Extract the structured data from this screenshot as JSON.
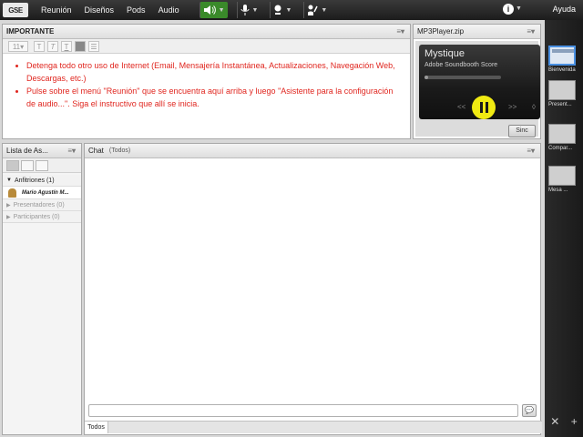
{
  "menu": {
    "logo": "GSE",
    "items": [
      "Reunión",
      "Diseños",
      "Pods",
      "Audio"
    ],
    "help": "Ayuda"
  },
  "notes_pod": {
    "title": "IMPORTANTE",
    "bullets": [
      "Detenga todo otro uso de Internet (Email, Mensajería Instantánea, Actualizaciones, Navegación Web, Descargas, etc.)",
      "Pulse sobre el menú \"Reunión\" que se encuentra aquí arriba y luego \"Asistente para la configuración de audio...\". Siga el instructivo que allí se inicia."
    ]
  },
  "mp3_pod": {
    "title": "MP3Player.zip",
    "track": "Mystique",
    "artist": "Adobe Soundbooth Score",
    "progress": 0.05,
    "prev": "<<",
    "next": ">>",
    "sync_label": "Sinc"
  },
  "attendees_pod": {
    "title": "Lista de As...",
    "groups": [
      {
        "label": "Anfitriones (1)",
        "expanded": true
      },
      {
        "label": "Presentadores (0)",
        "expanded": false
      },
      {
        "label": "Participantes (0)",
        "expanded": false
      }
    ],
    "hosts": [
      "Mario Agustín M..."
    ]
  },
  "chat_pod": {
    "title": "Chat",
    "subtitle": "(Todos)",
    "tab": "Todos"
  },
  "layouts": [
    {
      "label": "Bienvenida",
      "selected": true
    },
    {
      "label": "Present...",
      "selected": false
    },
    {
      "label": "Compar...",
      "selected": false
    },
    {
      "label": "Mesa ...",
      "selected": false
    }
  ],
  "colors": {
    "notes_text": "#e0261f",
    "mic_active": "#3a8a2a",
    "highlight": "#f0ea12",
    "layout_selected": "#4a90e2"
  }
}
